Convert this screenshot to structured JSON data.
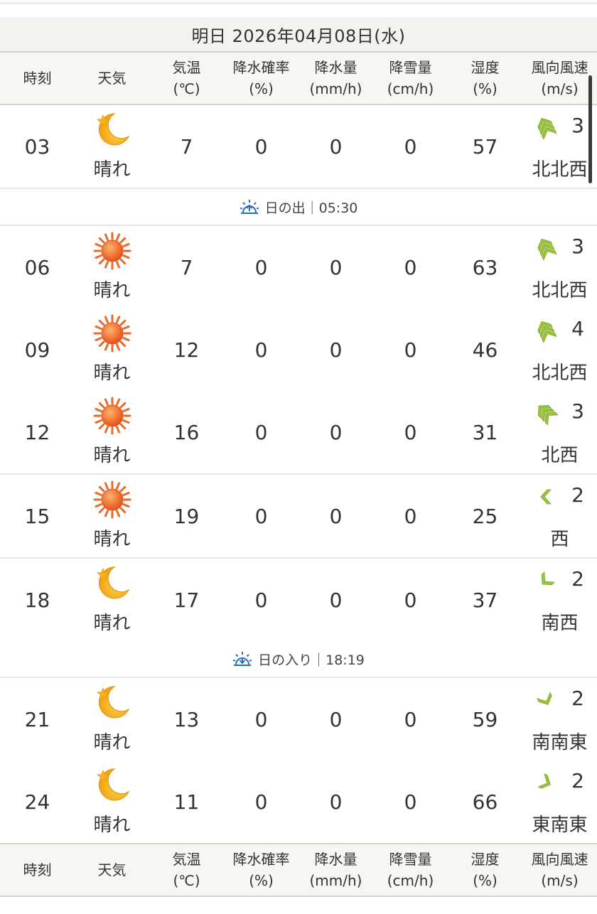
{
  "title": "明日 2026年04月08日(水)",
  "headers": {
    "time": "時刻",
    "weather": "天気",
    "temp": "気温",
    "temp_unit": "(℃)",
    "prob": "降水確率",
    "prob_unit": "(%)",
    "precip": "降水量",
    "precip_unit": "(mm/h)",
    "snow": "降雪量",
    "snow_unit": "(cm/h)",
    "humid": "湿度",
    "humid_unit": "(%)",
    "wind": "風向風速",
    "wind_unit": "(m/s)"
  },
  "sunrise": "日の出｜05:30",
  "sunset": "日の入り｜18:19",
  "rows": [
    {
      "time": "03",
      "icon": "moon-icon",
      "weather": "晴れ",
      "temp": "7",
      "prob": "0",
      "precip": "0",
      "snow": "0",
      "humid": "57",
      "wind_speed": "3",
      "wind_dir": "北北西",
      "wind_icon": "wind-nnw-icon"
    },
    {
      "time": "06",
      "icon": "sun-icon",
      "weather": "晴れ",
      "temp": "7",
      "prob": "0",
      "precip": "0",
      "snow": "0",
      "humid": "63",
      "wind_speed": "3",
      "wind_dir": "北北西",
      "wind_icon": "wind-nnw-icon"
    },
    {
      "time": "09",
      "icon": "sun-icon",
      "weather": "晴れ",
      "temp": "12",
      "prob": "0",
      "precip": "0",
      "snow": "0",
      "humid": "46",
      "wind_speed": "4",
      "wind_dir": "北北西",
      "wind_icon": "wind-nnw-icon"
    },
    {
      "time": "12",
      "icon": "sun-icon",
      "weather": "晴れ",
      "temp": "16",
      "prob": "0",
      "precip": "0",
      "snow": "0",
      "humid": "31",
      "wind_speed": "3",
      "wind_dir": "北西",
      "wind_icon": "wind-nw-icon"
    },
    {
      "time": "15",
      "icon": "sun-icon",
      "weather": "晴れ",
      "temp": "19",
      "prob": "0",
      "precip": "0",
      "snow": "0",
      "humid": "25",
      "wind_speed": "2",
      "wind_dir": "西",
      "wind_icon": "wind-w-icon"
    },
    {
      "time": "18",
      "icon": "moon-icon",
      "weather": "晴れ",
      "temp": "17",
      "prob": "0",
      "precip": "0",
      "snow": "0",
      "humid": "37",
      "wind_speed": "2",
      "wind_dir": "南西",
      "wind_icon": "wind-sw-icon"
    },
    {
      "time": "21",
      "icon": "moon-icon",
      "weather": "晴れ",
      "temp": "13",
      "prob": "0",
      "precip": "0",
      "snow": "0",
      "humid": "59",
      "wind_speed": "2",
      "wind_dir": "南南東",
      "wind_icon": "wind-sse-icon"
    },
    {
      "time": "24",
      "icon": "moon-icon",
      "weather": "晴れ",
      "temp": "11",
      "prob": "0",
      "precip": "0",
      "snow": "0",
      "humid": "66",
      "wind_speed": "2",
      "wind_dir": "東南東",
      "wind_icon": "wind-ese-icon"
    }
  ]
}
